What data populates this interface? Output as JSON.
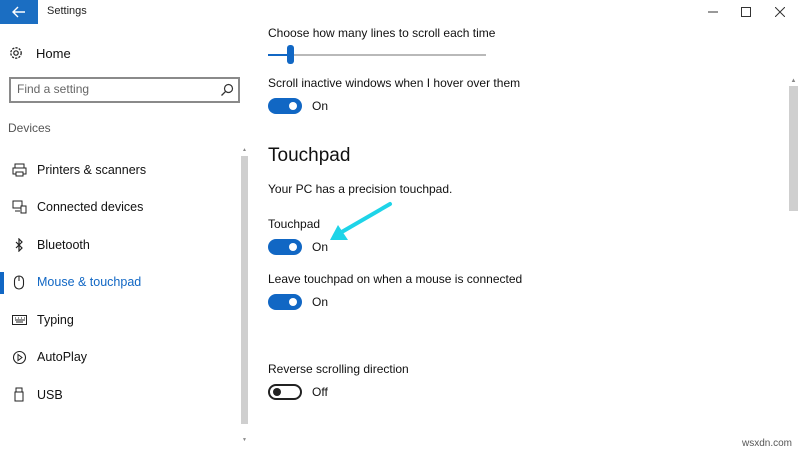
{
  "window": {
    "title": "Settings",
    "back_icon": "back-arrow-icon",
    "controls": [
      "minimize",
      "maximize",
      "close"
    ]
  },
  "sidebar": {
    "home_label": "Home",
    "search_placeholder": "Find a setting",
    "section_label": "Devices",
    "items": [
      {
        "label": "Printers & scanners",
        "icon": "printer-icon",
        "active": false
      },
      {
        "label": "Connected devices",
        "icon": "connected-devices-icon",
        "active": false
      },
      {
        "label": "Bluetooth",
        "icon": "bluetooth-icon",
        "active": false
      },
      {
        "label": "Mouse & touchpad",
        "icon": "mouse-icon",
        "active": true
      },
      {
        "label": "Typing",
        "icon": "keyboard-icon",
        "active": false
      },
      {
        "label": "AutoPlay",
        "icon": "autoplay-icon",
        "active": false
      },
      {
        "label": "USB",
        "icon": "usb-icon",
        "active": false
      }
    ]
  },
  "main": {
    "scroll_lines_label": "Choose how many lines to scroll each time",
    "scroll_lines_value_fraction": 0.1,
    "scroll_inactive_label": "Scroll inactive windows when I hover over them",
    "scroll_inactive_state": "On",
    "touchpad_heading": "Touchpad",
    "precision_text": "Your PC has a precision touchpad.",
    "touchpad_label": "Touchpad",
    "touchpad_state": "On",
    "leave_on_label": "Leave touchpad on when a mouse is connected",
    "leave_on_state": "On",
    "reverse_label": "Reverse scrolling direction",
    "reverse_state": "Off"
  },
  "watermark": "wsxdn.com",
  "colors": {
    "accent": "#1167c4",
    "back_button": "#1b6ec2",
    "annotation_arrow": "#1ed4e8"
  }
}
